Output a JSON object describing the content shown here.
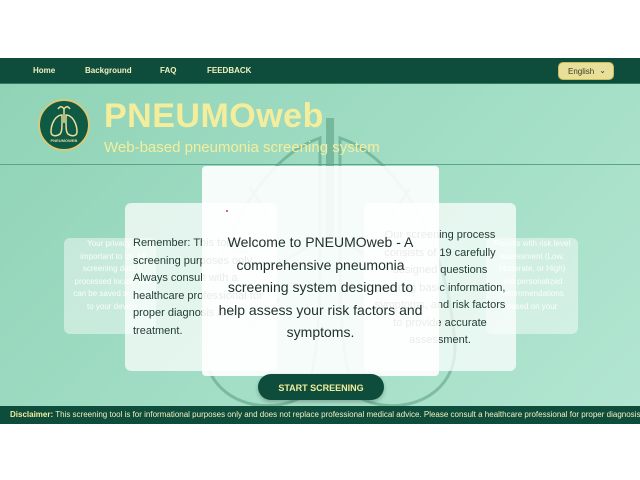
{
  "nav": {
    "links": [
      "Home",
      "Background",
      "FAQ",
      "FEEDBACK"
    ],
    "language": "English"
  },
  "header": {
    "title": "PNEUMOweb",
    "subtitle": "Web-based pneumonia screening system",
    "logo_text": "PNEUMOWEB"
  },
  "cards": {
    "far_left": "Your privacy is important to us. All screening data is processed locally and can be saved securely to your device.",
    "far_right": "Results with risk level assessment (Low, Moderate, or High) and personalized recommendations based on your",
    "left": "Remember: This tool is for screening purposes only. Always consult with a healthcare professional for proper diagnosis and treatment.",
    "right": "Our screening process consists of 19 carefully designed questions covering basic information, symptoms, and risk factors to provide accurate assessment.",
    "center": "Welcome to PNEUMOweb - A comprehensive pneumonia screening system designed to help assess your risk factors and symptoms."
  },
  "start_button": "START SCREENING",
  "disclaimer": {
    "label": "Disclaimer:",
    "text": "This screening tool is for informational purposes only and does not replace professional medical advice. Please consult a healthcare professional for proper diagnosis and"
  },
  "colors": {
    "nav_bg": "#0e4d3c",
    "accent_yellow": "#f4ee9c",
    "background": "#9fdcc3"
  }
}
